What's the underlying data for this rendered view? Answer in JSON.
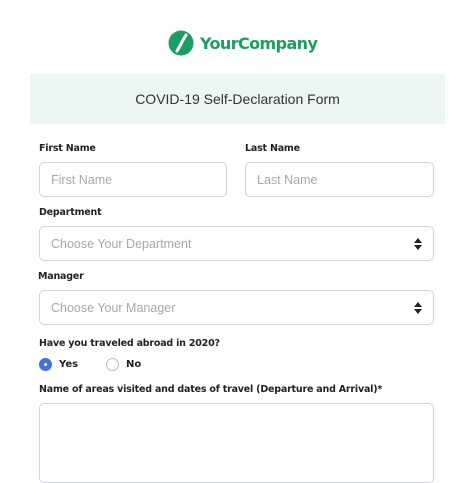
{
  "brand": {
    "name": "YourCompany",
    "color": "#1e9d62"
  },
  "form": {
    "title": "COVID-19 Self-Declaration Form",
    "first_name": {
      "label": "First Name",
      "placeholder": "First Name",
      "value": ""
    },
    "last_name": {
      "label": "Last Name",
      "placeholder": "Last Name",
      "value": ""
    },
    "department": {
      "label": "Department",
      "selected": "Choose Your Department"
    },
    "manager": {
      "label": "Manager",
      "selected": "Choose Your Manager"
    },
    "traveled": {
      "label": "Have you traveled abroad in 2020?",
      "options": [
        {
          "label": "Yes",
          "checked": true
        },
        {
          "label": "No",
          "checked": false
        }
      ]
    },
    "areas_visited": {
      "label": "Name of areas visited and dates of travel (Departure and Arrival)*",
      "value": ""
    }
  },
  "colors": {
    "banner_bg": "#ebf7f1",
    "radio_accent": "#3d74e0",
    "border": "#cfd4da"
  }
}
